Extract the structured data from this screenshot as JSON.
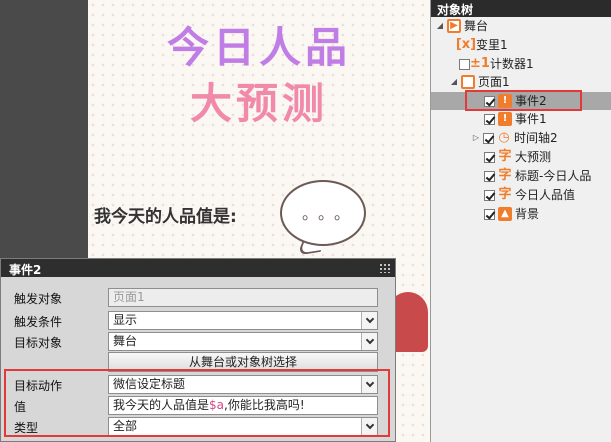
{
  "canvas": {
    "title_line1": "今日人品",
    "title_line2": "大预测",
    "prompt": "我今天的人品值是:",
    "bubble_dots": "。。。"
  },
  "object_tree": {
    "header": "对象树",
    "items": [
      {
        "label": "舞台",
        "icon": "stage-icon"
      },
      {
        "label": "变里1",
        "icon": "variable-icon"
      },
      {
        "label": "计数器1",
        "icon": "counter-icon"
      },
      {
        "label": "页面1",
        "icon": "page-icon"
      },
      {
        "label": "事件2",
        "icon": "event-icon",
        "checked": true,
        "selected": true
      },
      {
        "label": "事件1",
        "icon": "event-icon",
        "checked": true
      },
      {
        "label": "时间轴2",
        "icon": "timeline-icon",
        "checked": true
      },
      {
        "label": "大预测",
        "icon": "text-icon",
        "checked": true
      },
      {
        "label": "标题-今日人品",
        "icon": "text-icon",
        "checked": true
      },
      {
        "label": "今日人品值",
        "icon": "text-icon",
        "checked": true
      },
      {
        "label": "背景",
        "icon": "image-icon",
        "checked": true
      }
    ]
  },
  "properties": {
    "title": "事件2",
    "trigger_object_label": "触发对象",
    "trigger_object_value": "页面1",
    "trigger_condition_label": "触发条件",
    "trigger_condition_value": "显示",
    "target_object_label": "目标对象",
    "target_object_value": "舞台",
    "select_button_label": "从舞台或对象树选择",
    "target_action_label": "目标动作",
    "target_action_value": "微信设定标题",
    "value_label": "值",
    "value_prefix": "我今天的人品值是",
    "value_var": "$a",
    "value_suffix": ",你能比我高吗!",
    "type_label": "类型",
    "type_value": "全部"
  },
  "colors": {
    "accent_orange": "#f07d2c",
    "highlight_red": "#e23a3a",
    "title_purple": "#c07de6",
    "title_pink": "#f18aaa"
  }
}
